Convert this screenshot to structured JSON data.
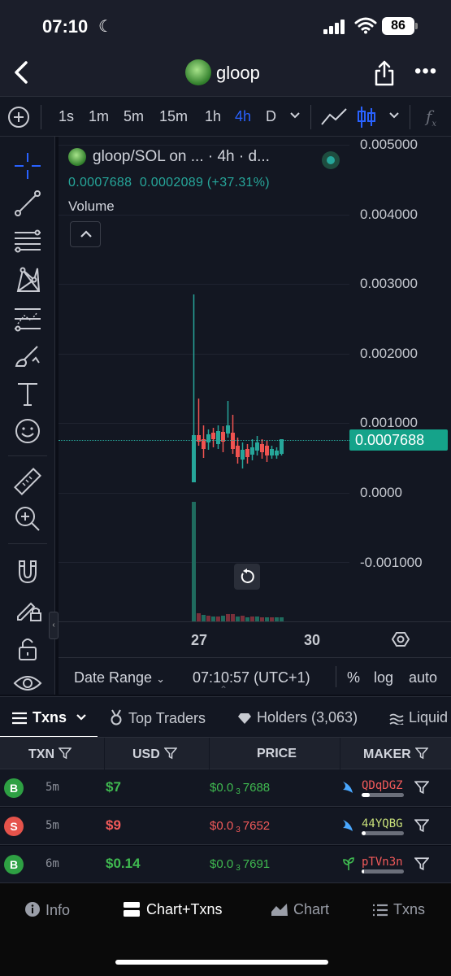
{
  "status_bar": {
    "time": "07:10",
    "battery": "86"
  },
  "header": {
    "title": "gloop"
  },
  "toolbar": {
    "intervals": [
      "1s",
      "1m",
      "5m",
      "15m",
      "1h",
      "4h",
      "D"
    ],
    "active_interval": "4h"
  },
  "chart": {
    "legend_title": "gloop/SOL on ... · 4h · d...",
    "legend_price": "0.0007688",
    "legend_change": "0.0002089 (+37.31%)",
    "volume_label": "Volume",
    "price_labels": [
      "0.005000",
      "0.004000",
      "0.003000",
      "0.002000",
      "0.001000",
      "0.0000",
      "-0.001000"
    ],
    "last_price": "0.0007688",
    "time_labels": [
      "27",
      "30"
    ]
  },
  "range_bar": {
    "date_range": "Date Range",
    "time": "07:10:57 (UTC+1)",
    "percent": "%",
    "log": "log",
    "auto": "auto"
  },
  "tabs": {
    "txns": "Txns",
    "top_traders": "Top Traders",
    "holders": "Holders (3,063)",
    "liquidity": "Liquid"
  },
  "table": {
    "headers": {
      "txn": "TXN",
      "usd": "USD",
      "price": "PRICE",
      "maker": "MAKER"
    },
    "rows": [
      {
        "side": "B",
        "age": "5m",
        "usd": "$7",
        "price_prefix": "$0.0",
        "price_sub": "3",
        "price_digits": "7688",
        "maker": "QDqDGZ"
      },
      {
        "side": "S",
        "age": "5m",
        "usd": "$9",
        "price_prefix": "$0.0",
        "price_sub": "3",
        "price_digits": "7652",
        "maker": "44YQBG"
      },
      {
        "side": "B",
        "age": "6m",
        "usd": "$0.14",
        "price_prefix": "$0.0",
        "price_sub": "3",
        "price_digits": "7691",
        "maker": "pTVn3n"
      }
    ]
  },
  "bottom_nav": {
    "info": "Info",
    "chart_txns": "Chart+Txns",
    "chart": "Chart",
    "txns": "Txns"
  },
  "colors": {
    "up": "#26a69a",
    "down": "#ef5350",
    "active_interval": "#2962ff",
    "buy": "#3fb950",
    "sell": "#f25a5a"
  }
}
